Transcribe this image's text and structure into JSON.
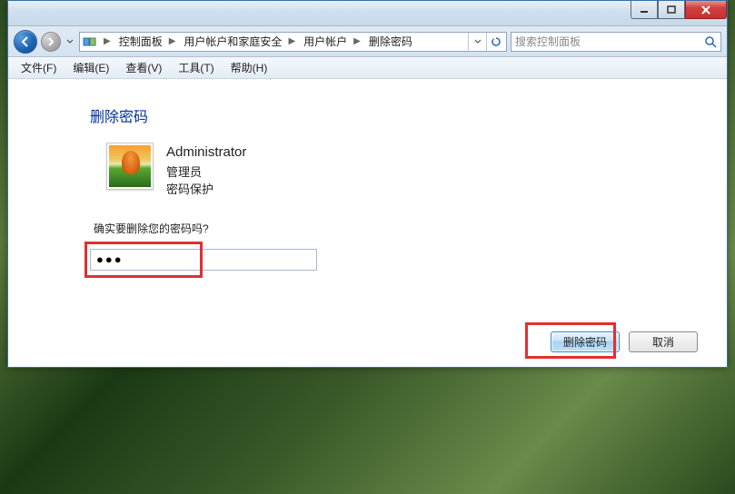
{
  "breadcrumbs": {
    "items": [
      "控制面板",
      "用户帐户和家庭安全",
      "用户帐户",
      "删除密码"
    ]
  },
  "search": {
    "placeholder": "搜索控制面板"
  },
  "menu": {
    "file": "文件(F)",
    "edit": "编辑(E)",
    "view": "查看(V)",
    "tools": "工具(T)",
    "help": "帮助(H)"
  },
  "page": {
    "title": "删除密码",
    "user": {
      "name": "Administrator",
      "role": "管理员",
      "protection": "密码保护"
    },
    "prompt": "确实要删除您的密码吗?",
    "password_value": "●●●"
  },
  "buttons": {
    "delete": "删除密码",
    "cancel": "取消"
  }
}
